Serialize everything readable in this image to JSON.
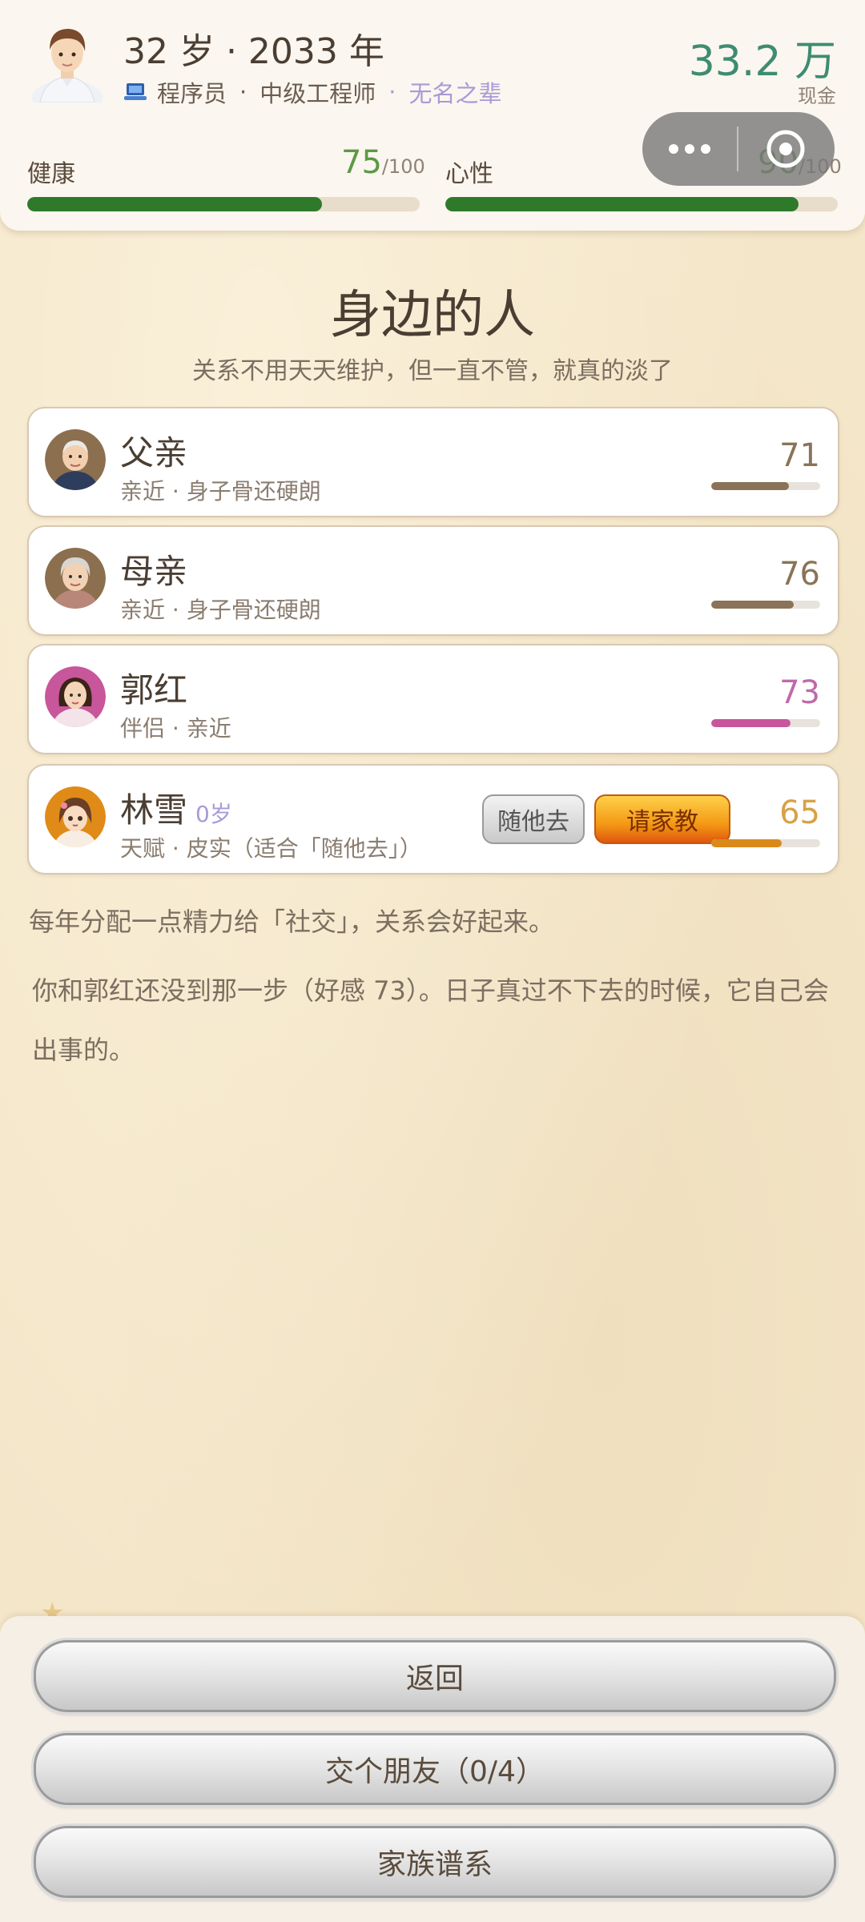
{
  "header": {
    "age_year": "32 岁 · 2033 年",
    "job": "程序员",
    "level": "中级工程师",
    "title": "无名之辈",
    "cash": "33.2 万",
    "cash_label": "现金",
    "health": {
      "label": "健康",
      "value": "75",
      "max": "/100",
      "fraction": 0.75
    },
    "mood": {
      "label": "心性",
      "value": "90",
      "max": "/100",
      "fraction": 0.9
    }
  },
  "main": {
    "title": "身边的人",
    "subtitle": "关系不用天天维护，但一直不管，就真的淡了"
  },
  "people": [
    {
      "name": "父亲",
      "age": "",
      "sub": "亲近 · 身子骨还硬朗",
      "value": "71",
      "fraction": 0.71,
      "color": "#8a7358"
    },
    {
      "name": "母亲",
      "age": "",
      "sub": "亲近 · 身子骨还硬朗",
      "value": "76",
      "fraction": 0.76,
      "color": "#8a7358"
    },
    {
      "name": "郭红",
      "age": "",
      "sub": "伴侣 · 亲近",
      "value": "73",
      "fraction": 0.73,
      "color": "#c8569b"
    },
    {
      "name": "林雪",
      "age": "0岁",
      "sub": "天赋 · 皮实（适合「随他去」）",
      "value": "65",
      "fraction": 0.65,
      "color": "#d98a1a",
      "btn_free": "随他去",
      "btn_tutor": "请家教"
    }
  ],
  "notice1": "每年分配一点精力给「社交」，关系会好起来。",
  "notice2": "你和郭红还没到那一步（好感 73）。日子真过不下去的时候，它自己会出事的。",
  "buttons": {
    "back": "返回",
    "make_friend": "交个朋友（0/4）",
    "family_tree": "家族谱系"
  },
  "icons": {
    "player_avatar": "male-avatar-icon",
    "job": "laptop-icon",
    "more": "more-dots-icon",
    "close": "target-icon"
  }
}
